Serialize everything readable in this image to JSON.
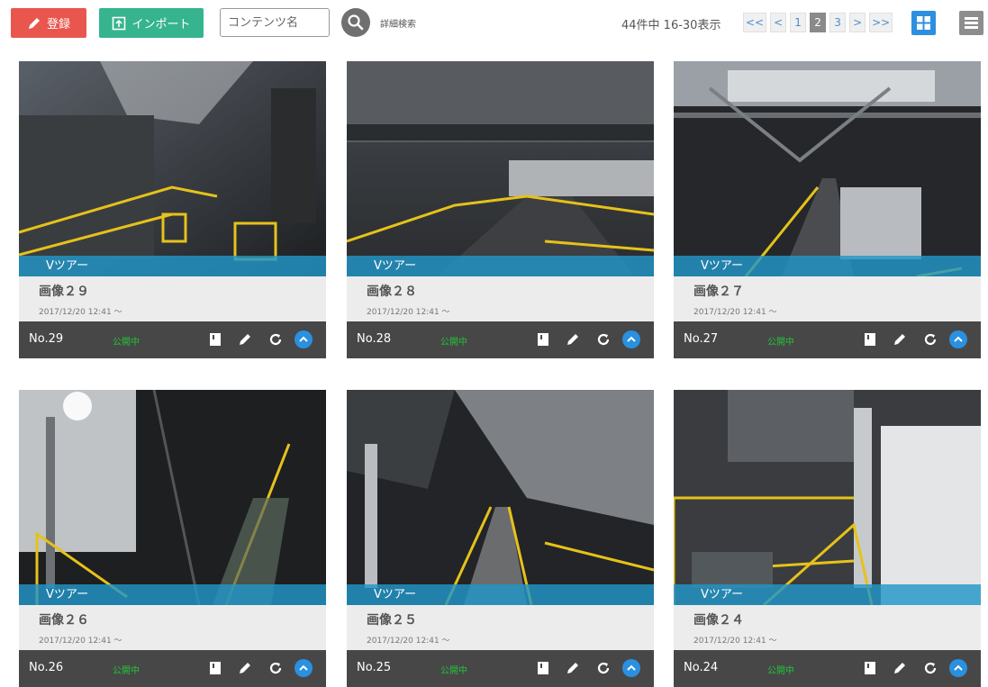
{
  "toolbar": {
    "register_label": "登録",
    "import_label": "インポート",
    "search_placeholder": "コンテンツ名",
    "advanced_search_label": "詳細検索",
    "paging_info": "44件中 16-30表示",
    "pager": [
      "<<",
      "<",
      "1",
      "2",
      "3",
      ">",
      ">>"
    ],
    "current_page": "2"
  },
  "colors": {
    "register": "#e8564e",
    "import": "#36b48e",
    "tour_band": "#2296c8",
    "status_text": "#24c23a",
    "grid_view_active": "#2d8fe0"
  },
  "cards": [
    {
      "tour_label": "Vツアー",
      "title": "画像２９",
      "date": "2017/12/20 12:41 ～",
      "number": "No.29",
      "status": "公開中"
    },
    {
      "tour_label": "Vツアー",
      "title": "画像２８",
      "date": "2017/12/20 12:41 ～",
      "number": "No.28",
      "status": "公開中"
    },
    {
      "tour_label": "Vツアー",
      "title": "画像２７",
      "date": "2017/12/20 12:41 ～",
      "number": "No.27",
      "status": "公開中"
    },
    {
      "tour_label": "Vツアー",
      "title": "画像２６",
      "date": "2017/12/20 12:41 ～",
      "number": "No.26",
      "status": "公開中"
    },
    {
      "tour_label": "Vツアー",
      "title": "画像２５",
      "date": "2017/12/20 12:41 ～",
      "number": "No.25",
      "status": "公開中"
    },
    {
      "tour_label": "Vツアー",
      "title": "画像２４",
      "date": "2017/12/20 12:41 ～",
      "number": "No.24",
      "status": "公開中"
    }
  ],
  "icons": [
    "pencil-icon",
    "upload-icon",
    "search-icon",
    "grid-view-icon",
    "list-view-icon",
    "document-icon",
    "edit-icon",
    "reload-icon",
    "chevron-up-icon"
  ]
}
